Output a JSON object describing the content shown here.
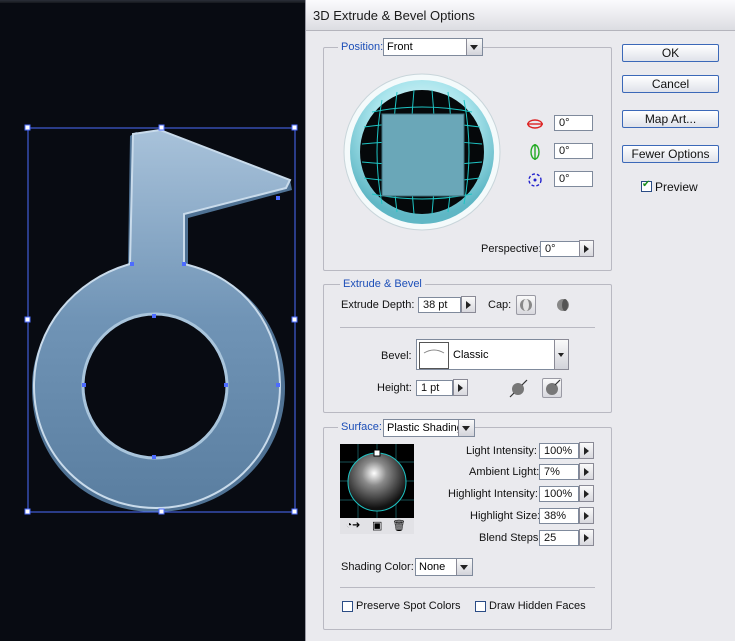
{
  "window": {
    "title": "3D Extrude & Bevel Options"
  },
  "position": {
    "label": "Position:",
    "value": "Front",
    "rotations": [
      {
        "icon": "x-axis-rotate-icon",
        "value": "0°"
      },
      {
        "icon": "y-axis-rotate-icon",
        "value": "0°"
      },
      {
        "icon": "z-axis-rotate-icon",
        "value": "0°"
      }
    ],
    "perspective_label": "Perspective:",
    "perspective_value": "0°"
  },
  "extrude": {
    "group_label": "Extrude & Bevel",
    "depth_label": "Extrude Depth:",
    "depth_value": "38 pt",
    "cap_label": "Cap:",
    "bevel_label": "Bevel:",
    "bevel_value": "Classic",
    "height_label": "Height:",
    "height_value": "1 pt"
  },
  "surface": {
    "label": "Surface:",
    "value": "Plastic Shading",
    "light_intensity_label": "Light Intensity:",
    "light_intensity_value": "100%",
    "ambient_light_label": "Ambient Light:",
    "ambient_light_value": "7%",
    "highlight_intensity_label": "Highlight Intensity:",
    "highlight_intensity_value": "100%",
    "highlight_size_label": "Highlight Size:",
    "highlight_size_value": "38%",
    "blend_steps_label": "Blend Steps:",
    "blend_steps_value": "25",
    "shading_color_label": "Shading Color:",
    "shading_color_value": "None"
  },
  "options": {
    "preserve_spot_label": "Preserve Spot Colors",
    "preserve_spot_checked": false,
    "draw_hidden_label": "Draw Hidden Faces",
    "draw_hidden_checked": false
  },
  "buttons": {
    "ok": "OK",
    "cancel": "Cancel",
    "map_art": "Map Art...",
    "fewer_options": "Fewer Options",
    "preview_label": "Preview",
    "preview_checked": true
  },
  "colors": {
    "shape_fill": "#6f93b4",
    "selection": "#4d6cff",
    "accent_label": "#1d4fb8",
    "cube_face": "#6aa7b8",
    "grid": "#1ec4c4"
  }
}
